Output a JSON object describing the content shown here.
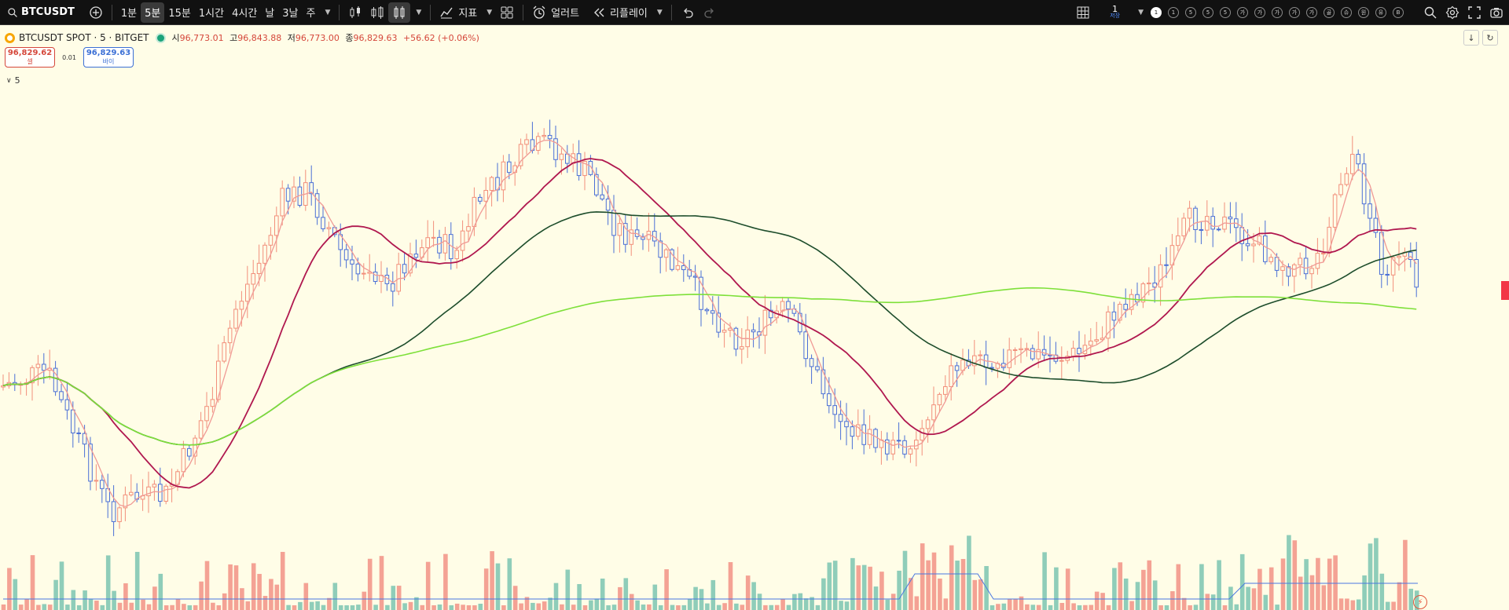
{
  "toolbar": {
    "symbol": "BTCUSDT",
    "intervals": [
      "1분",
      "5분",
      "15분",
      "1시간",
      "4시간",
      "날",
      "3날",
      "주"
    ],
    "active_interval": "5분",
    "indicators_label": "지표",
    "alerts_label": "얼러트",
    "replay_label": "리플레이",
    "layout": {
      "number": "1",
      "sub": "저장"
    },
    "templates": [
      "1",
      "1",
      "5",
      "5",
      "5",
      "가",
      "가",
      "가",
      "가",
      "가",
      "골",
      "슈",
      "원",
      "유",
      "B"
    ]
  },
  "legend": {
    "title": "BTCUSDT SPOT · 5 · BITGET",
    "open_label": "시",
    "open": "96,773.01",
    "high_label": "고",
    "high": "96,843.88",
    "low_label": "저",
    "low": "96,773.00",
    "close_label": "종",
    "close": "96,829.63",
    "change": "+56.62 (+0.06%)"
  },
  "order": {
    "sell_price": "96,829.62",
    "sell_label": "셀",
    "spread": "0.01",
    "buy_price": "96,829.63",
    "buy_label": "바이"
  },
  "collapse": {
    "count": "5"
  },
  "colors": {
    "up": "#f28f7b",
    "down": "#4a6fd6",
    "ma_fast": "#f09a95",
    "ma_mid": "#b0184f",
    "ma_slow": "#1d4d2b",
    "ma_long": "#7ee03a",
    "vol_up": "#f4a294",
    "vol_down": "#8fcdb9",
    "vol_ma": "#4a78e0",
    "background": "#fffde7"
  },
  "icons": [
    "add-symbol-icon",
    "candle-type-icon",
    "bar-type-icon",
    "hollow-candle-icon",
    "indicators-icon",
    "templates-icon",
    "alert-clock-icon",
    "replay-icon",
    "undo-icon",
    "redo-icon",
    "layout-grid-icon",
    "search-icon",
    "settings-icon",
    "fullscreen-icon",
    "camera-icon",
    "scroll-down-icon",
    "reset-icon",
    "bolt-icon"
  ]
}
